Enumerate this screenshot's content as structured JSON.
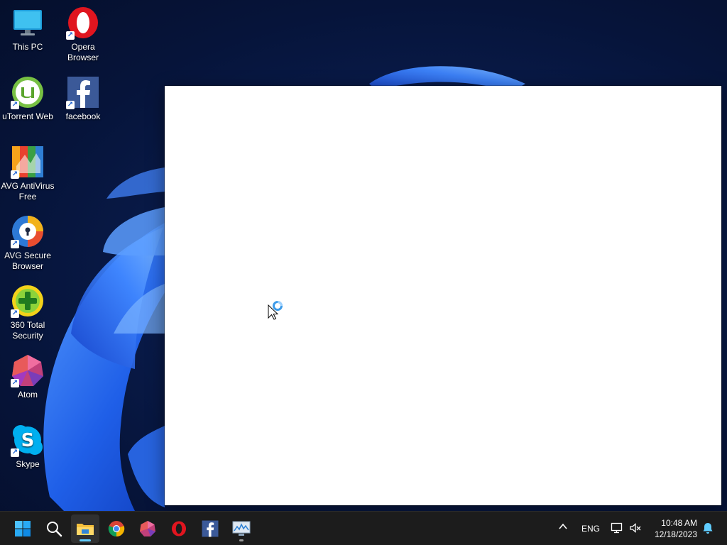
{
  "desktop": {
    "icons": [
      {
        "label": "This PC",
        "icon": "this-pc-icon",
        "shortcut": false
      },
      {
        "label": "Opera Browser",
        "icon": "opera-icon",
        "shortcut": true
      },
      {
        "label": "uTorrent Web",
        "icon": "utorrent-icon",
        "shortcut": true
      },
      {
        "label": "facebook",
        "icon": "facebook-icon",
        "shortcut": true
      },
      {
        "label": "AVG AntiVirus Free",
        "icon": "avg-antivirus-icon",
        "shortcut": true
      },
      {
        "label": "AVG Secure Browser",
        "icon": "avg-secure-browser-icon",
        "shortcut": true
      },
      {
        "label": "360 Total Security",
        "icon": "360-total-security-icon",
        "shortcut": true
      },
      {
        "label": "Atom",
        "icon": "atom-icon",
        "shortcut": true
      },
      {
        "label": "Skype",
        "icon": "skype-icon",
        "shortcut": true
      }
    ],
    "shortcut_glyph": "↗"
  },
  "splash_window": {
    "state": "loading"
  },
  "cursor": {
    "type": "working-in-background"
  },
  "taskbar": {
    "pinned": [
      {
        "name": "start",
        "icon": "windows-start-icon"
      },
      {
        "name": "search",
        "icon": "search-icon"
      },
      {
        "name": "file-explorer",
        "icon": "file-explorer-icon",
        "active": true
      },
      {
        "name": "chrome",
        "icon": "chrome-icon"
      },
      {
        "name": "atom",
        "icon": "atom-icon"
      },
      {
        "name": "opera",
        "icon": "opera-icon"
      },
      {
        "name": "facebook",
        "icon": "facebook-icon"
      },
      {
        "name": "resource-monitor",
        "icon": "monitor-chart-icon",
        "running": true
      }
    ],
    "tray": {
      "overflow_glyph": "^",
      "language": "ENG",
      "time": "10:48 AM",
      "date": "12/18/2023"
    }
  },
  "colors": {
    "accent": "#60cdff",
    "taskbar": "#1c1c1c",
    "wallpaper": "#0a1d4f"
  }
}
